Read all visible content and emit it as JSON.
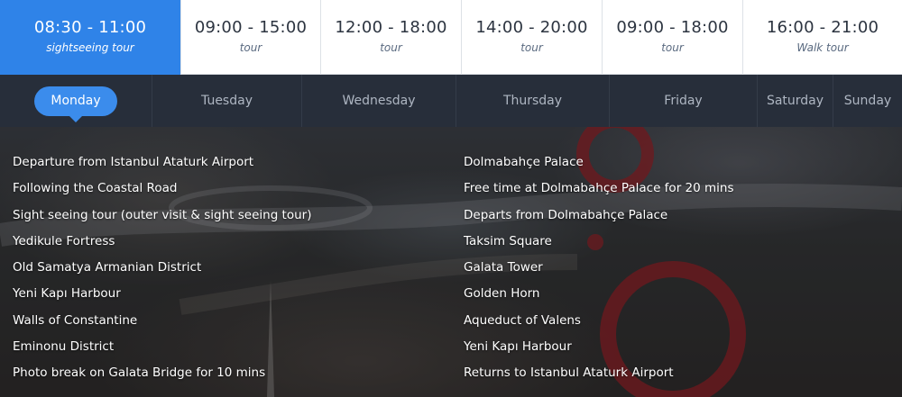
{
  "time_slots": [
    {
      "time": "08:30 - 11:00",
      "kind": "sightseeing tour",
      "active": true
    },
    {
      "time": "09:00 - 15:00",
      "kind": "tour",
      "active": false
    },
    {
      "time": "12:00 - 18:00",
      "kind": "tour",
      "active": false
    },
    {
      "time": "14:00 - 20:00",
      "kind": "tour",
      "active": false
    },
    {
      "time": "09:00 - 18:00",
      "kind": "tour",
      "active": false
    },
    {
      "time": "16:00 - 21:00",
      "kind": "Walk tour",
      "active": false
    }
  ],
  "days": [
    {
      "label": "Monday",
      "active": true
    },
    {
      "label": "Tuesday",
      "active": false
    },
    {
      "label": "Wednesday",
      "active": false
    },
    {
      "label": "Thursday",
      "active": false
    },
    {
      "label": "Friday",
      "active": false
    },
    {
      "label": "Saturday",
      "active": false
    },
    {
      "label": "Sunday",
      "active": false
    }
  ],
  "itinerary": {
    "left": [
      "Departure from Istanbul Ataturk Airport",
      "Following the Coastal Road",
      "Sight seeing tour (outer visit & sight seeing tour)",
      "Yedikule Fortress",
      "Old Samatya Armanian District",
      "Yeni Kapı Harbour",
      "Walls of Constantine",
      "Eminonu District",
      "Photo break on Galata Bridge for 10 mins"
    ],
    "right": [
      "Dolmabahçe Palace",
      "Free time at Dolmabahçe Palace for 20 mins",
      "Departs from Dolmabahçe Palace",
      "Taksim Square",
      "Galata Tower",
      "Golden Horn",
      "Aqueduct of Valens",
      "Yeni Kapı Harbour",
      "Returns to Istanbul Ataturk Airport"
    ]
  },
  "colors": {
    "accent": "#2f83e8",
    "tab_bar": "#272e3a",
    "decor_ring": "#9a1b1f"
  },
  "icons": {
    "background_decor": "map-pin-ring-decoration"
  }
}
